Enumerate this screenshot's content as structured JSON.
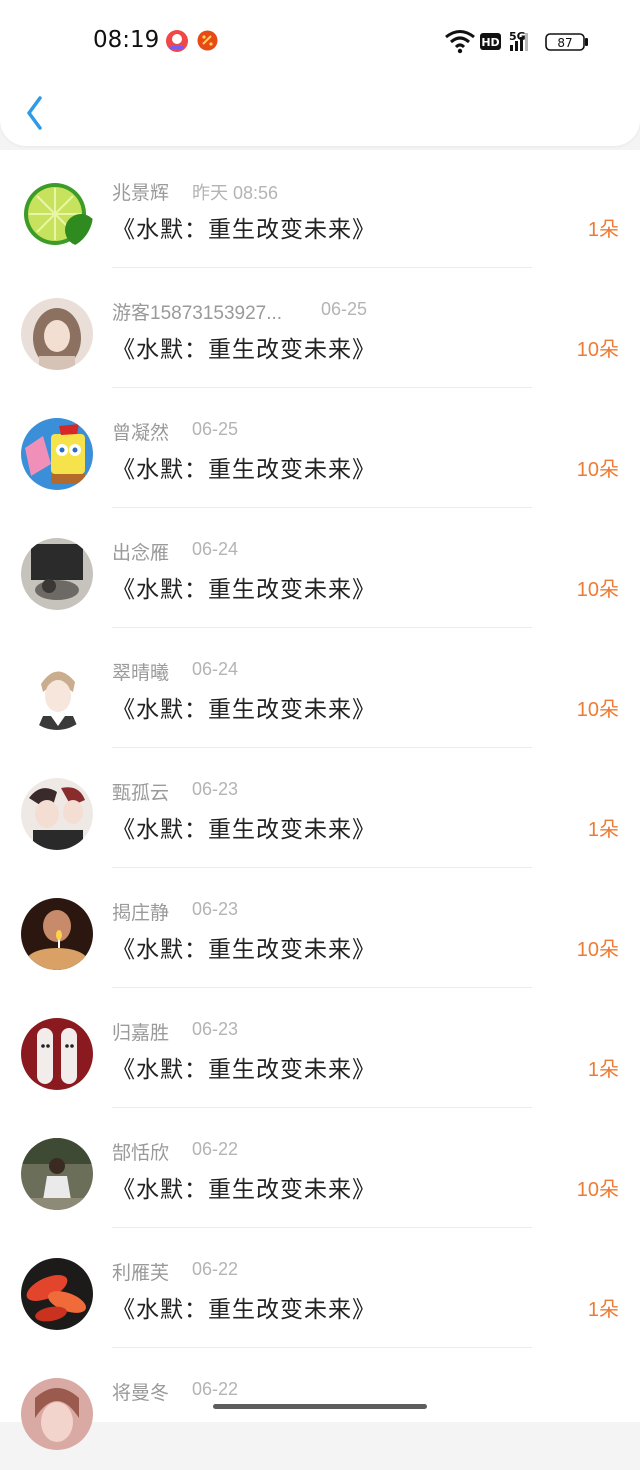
{
  "status_bar": {
    "time": "08:19",
    "network_label": "5G",
    "hd_label": "HD",
    "battery": "87",
    "icons": [
      "app-red-circle-icon",
      "app-orange-badge-icon",
      "wifi-icon",
      "hd-icon",
      "signal-icon",
      "battery-icon"
    ]
  },
  "header": {
    "back_icon": "chevron-left-icon",
    "accent_color": "#2f9be6"
  },
  "colors": {
    "count": "#ee7b35",
    "name": "#9a9a9a",
    "date": "#b4b4b4",
    "title": "#222222"
  },
  "rows": [
    {
      "name": "兆景辉",
      "date": "昨天 08:56",
      "title": "《水默：重生改变未来》",
      "count": "1朵",
      "avatar": "lime-avatar"
    },
    {
      "name": "游客15873153927...",
      "date": "06-25",
      "title": "《水默：重生改变未来》",
      "count": "10朵",
      "avatar": "girl-portrait-avatar"
    },
    {
      "name": "曾凝然",
      "date": "06-25",
      "title": "《水默：重生改变未来》",
      "count": "10朵",
      "avatar": "cartoon-avatar"
    },
    {
      "name": "出念雁",
      "date": "06-24",
      "title": "《水默：重生改变未来》",
      "count": "10朵",
      "avatar": "dark-photo-avatar"
    },
    {
      "name": "翠晴曦",
      "date": "06-24",
      "title": "《水默：重生改变未来》",
      "count": "10朵",
      "avatar": "anime-boy-avatar"
    },
    {
      "name": "甄孤云",
      "date": "06-23",
      "title": "《水默：重生改变未来》",
      "count": "1朵",
      "avatar": "anime-group-avatar"
    },
    {
      "name": "揭庄静",
      "date": "06-23",
      "title": "《水默：重生改变未来》",
      "count": "10朵",
      "avatar": "candle-avatar"
    },
    {
      "name": "归嘉胜",
      "date": "06-23",
      "title": "《水默：重生改变未来》",
      "count": "1朵",
      "avatar": "red-figures-avatar"
    },
    {
      "name": "郜恬欣",
      "date": "06-22",
      "title": "《水默：重生改变未来》",
      "count": "10朵",
      "avatar": "outdoor-boy-avatar"
    },
    {
      "name": "利雁芙",
      "date": "06-22",
      "title": "《水默：重生改变未来》",
      "count": "1朵",
      "avatar": "red-leaves-avatar"
    },
    {
      "name": "将曼冬",
      "date": "06-22",
      "title": "",
      "count": "",
      "avatar": "portrait-avatar"
    }
  ]
}
